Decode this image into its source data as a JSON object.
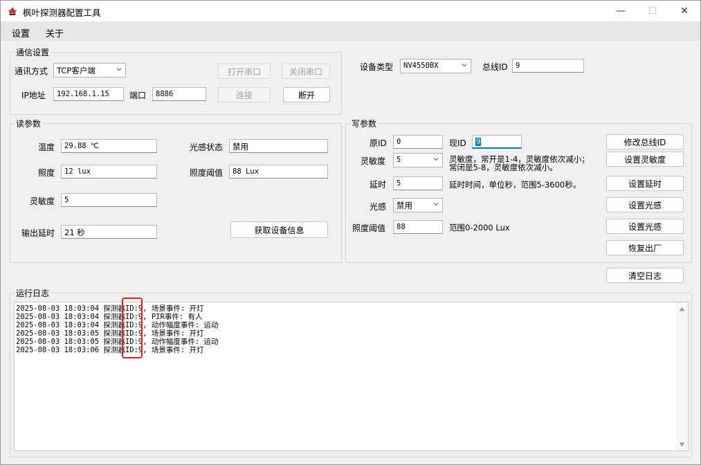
{
  "window": {
    "title": "枫叶探测器配置工具",
    "minimize_glyph": "—",
    "maximize_glyph": "☐",
    "close_glyph": "✕"
  },
  "menu": {
    "items": [
      "设置",
      "关于"
    ]
  },
  "comm": {
    "group_label": "通信设置",
    "mode_label": "通讯方式",
    "mode_value": "TCP客户端",
    "ip_label": "IP地址",
    "ip_value": "192.168.1.15",
    "port_label": "端口",
    "port_value": "8886",
    "open_serial": "打开串口",
    "close_serial": "关闭串口",
    "connect": "连接",
    "disconnect": "断开"
  },
  "device": {
    "type_label": "设备类型",
    "type_value": "NV4550BX",
    "bus_id_label": "总线ID",
    "bus_id_value": "9"
  },
  "read": {
    "group_label": "读参数",
    "temp_label": "温度",
    "temp_value": "29.88 ℃",
    "illum_label": "照度",
    "illum_value": "12 lux",
    "sens_label": "灵敏度",
    "sens_value": "5",
    "delay_label": "输出延时",
    "delay_value": "21 秒",
    "light_state_label": "光感状态",
    "light_state_value": "禁用",
    "illum_thresh_label": "照度阈值",
    "illum_thresh_value": "88 Lux",
    "get_info": "获取设备信息"
  },
  "write": {
    "group_label": "写参数",
    "orig_id_label": "原ID",
    "orig_id_value": "0",
    "new_id_label": "现ID",
    "new_id_value": "9",
    "sens_label": "灵敏度",
    "sens_value": "5",
    "sens_hint_1": "灵敏度，常开是1-4，灵敏度依次减小；",
    "sens_hint_2": "常闭是5-8，灵敏度依次减小。",
    "delay_label": "延时",
    "delay_value": "5",
    "delay_hint": "延时时间，单位秒，范围5-3600秒。",
    "light_label": "光感",
    "light_value": "禁用",
    "thresh_label": "照度阈值",
    "thresh_value": "88",
    "thresh_hint": "范围0-2000 Lux",
    "btn_modify_bus_id": "修改总线ID",
    "btn_set_sens": "设置灵敏度",
    "btn_set_delay": "设置延时",
    "btn_set_light": "设置光感",
    "btn_set_light_2": "设置光感",
    "btn_factory": "恢复出厂"
  },
  "log": {
    "clear_button": "清空日志",
    "group_label": "运行日志",
    "lines": [
      "2025-08-03 18:03:04 探测器ID:9, 场景事件: 开灯",
      "2025-08-03 18:03:04 探测器ID:9, PIR事件: 有人",
      "2025-08-03 18:03:04 探测器ID:9, 动作幅度事件: 运动",
      "2025-08-03 18:03:05 探测器ID:9, 场景事件: 开灯",
      "2025-08-03 18:03:05 探测器ID:9, 动作幅度事件: 运动",
      "2025-08-03 18:03:06 探测器ID:9, 场景事件: 开灯"
    ]
  },
  "colors": {
    "highlight": "#e02020",
    "selection": "#0078d7"
  }
}
